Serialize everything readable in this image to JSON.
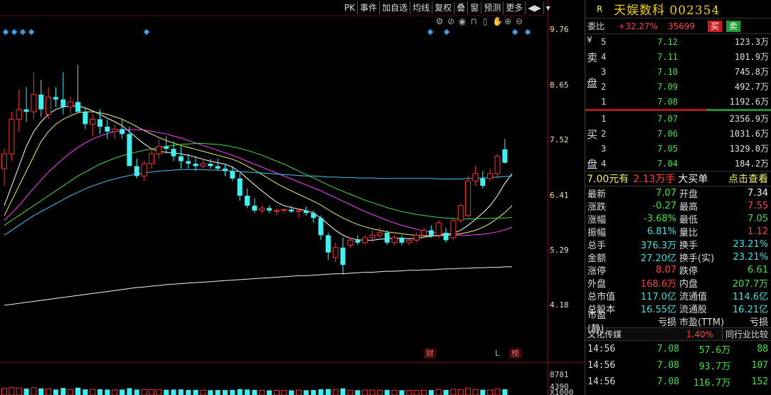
{
  "toolbar": [
    "PK",
    "事件",
    "加自选",
    "均线",
    "复权",
    "叠",
    "窗",
    "预测",
    "更多",
    "◀▶",
    "▾"
  ],
  "chart_data": {
    "type": "candlestick",
    "ylim": [
      3.8,
      10.2
    ],
    "price_ticks": [
      "9.76",
      "8.65",
      "7.52",
      "6.41",
      "5.29",
      "4.18"
    ],
    "volume_ticks": [
      "8781",
      "4390",
      "X1000"
    ],
    "candles": [
      {
        "o": 6.95,
        "h": 7.35,
        "l": 6.6,
        "c": 7.25
      },
      {
        "o": 7.25,
        "h": 8.1,
        "l": 7.1,
        "c": 7.95
      },
      {
        "o": 7.95,
        "h": 8.55,
        "l": 7.7,
        "c": 8.15
      },
      {
        "o": 8.15,
        "h": 8.6,
        "l": 7.9,
        "c": 8.1
      },
      {
        "o": 8.1,
        "h": 8.9,
        "l": 7.95,
        "c": 8.45
      },
      {
        "o": 8.45,
        "h": 8.75,
        "l": 8.0,
        "c": 8.15
      },
      {
        "o": 8.05,
        "h": 8.6,
        "l": 7.95,
        "c": 8.4
      },
      {
        "o": 8.4,
        "h": 8.6,
        "l": 8.2,
        "c": 8.35
      },
      {
        "o": 8.35,
        "h": 8.9,
        "l": 8.05,
        "c": 8.2
      },
      {
        "o": 8.2,
        "h": 8.4,
        "l": 8.05,
        "c": 8.3
      },
      {
        "o": 8.3,
        "h": 9.05,
        "l": 8.1,
        "c": 8.1
      },
      {
        "o": 8.1,
        "h": 8.2,
        "l": 7.75,
        "c": 7.85
      },
      {
        "o": 7.85,
        "h": 8.05,
        "l": 7.6,
        "c": 7.95
      },
      {
        "o": 7.95,
        "h": 8.15,
        "l": 7.65,
        "c": 7.8
      },
      {
        "o": 7.8,
        "h": 7.95,
        "l": 7.55,
        "c": 7.7
      },
      {
        "o": 7.7,
        "h": 7.85,
        "l": 7.55,
        "c": 7.75
      },
      {
        "o": 7.75,
        "h": 7.95,
        "l": 7.55,
        "c": 7.65
      },
      {
        "o": 7.65,
        "h": 7.8,
        "l": 7.0,
        "c": 7.0
      },
      {
        "o": 7.0,
        "h": 7.15,
        "l": 6.75,
        "c": 6.8
      },
      {
        "o": 6.8,
        "h": 7.1,
        "l": 6.7,
        "c": 7.05
      },
      {
        "o": 7.05,
        "h": 7.35,
        "l": 6.95,
        "c": 7.25
      },
      {
        "o": 7.25,
        "h": 7.55,
        "l": 7.15,
        "c": 7.4
      },
      {
        "o": 7.4,
        "h": 7.6,
        "l": 7.25,
        "c": 7.35
      },
      {
        "o": 7.35,
        "h": 7.5,
        "l": 7.1,
        "c": 7.2
      },
      {
        "o": 7.2,
        "h": 7.4,
        "l": 6.95,
        "c": 7.1
      },
      {
        "o": 7.1,
        "h": 7.25,
        "l": 6.95,
        "c": 7.05
      },
      {
        "o": 7.05,
        "h": 7.2,
        "l": 6.9,
        "c": 7.0
      },
      {
        "o": 7.0,
        "h": 7.15,
        "l": 6.95,
        "c": 7.05
      },
      {
        "o": 7.05,
        "h": 7.15,
        "l": 6.95,
        "c": 7.0
      },
      {
        "o": 7.0,
        "h": 7.15,
        "l": 6.9,
        "c": 6.95
      },
      {
        "o": 6.95,
        "h": 7.05,
        "l": 6.8,
        "c": 6.9
      },
      {
        "o": 6.9,
        "h": 7.0,
        "l": 6.7,
        "c": 6.75
      },
      {
        "o": 6.75,
        "h": 6.85,
        "l": 6.3,
        "c": 6.4
      },
      {
        "o": 6.4,
        "h": 6.55,
        "l": 6.15,
        "c": 6.2
      },
      {
        "o": 6.2,
        "h": 6.35,
        "l": 6.05,
        "c": 6.1
      },
      {
        "o": 6.1,
        "h": 6.2,
        "l": 6.05,
        "c": 6.15
      },
      {
        "o": 6.15,
        "h": 6.2,
        "l": 6.05,
        "c": 6.1
      },
      {
        "o": 6.1,
        "h": 6.15,
        "l": 6.0,
        "c": 6.1
      },
      {
        "o": 6.1,
        "h": 6.15,
        "l": 6.05,
        "c": 6.12
      },
      {
        "o": 6.12,
        "h": 6.2,
        "l": 6.05,
        "c": 6.08
      },
      {
        "o": 6.08,
        "h": 6.15,
        "l": 5.95,
        "c": 6.1
      },
      {
        "o": 6.1,
        "h": 6.18,
        "l": 6.0,
        "c": 6.05
      },
      {
        "o": 6.05,
        "h": 6.1,
        "l": 5.85,
        "c": 5.95
      },
      {
        "o": 5.95,
        "h": 6.0,
        "l": 5.5,
        "c": 5.6
      },
      {
        "o": 5.6,
        "h": 5.65,
        "l": 5.1,
        "c": 5.25
      },
      {
        "o": 5.15,
        "h": 5.45,
        "l": 5.05,
        "c": 5.35
      },
      {
        "o": 5.35,
        "h": 5.55,
        "l": 4.8,
        "c": 5.0
      },
      {
        "o": 5.4,
        "h": 5.55,
        "l": 5.35,
        "c": 5.5
      },
      {
        "o": 5.5,
        "h": 5.6,
        "l": 5.4,
        "c": 5.45
      },
      {
        "o": 5.45,
        "h": 5.6,
        "l": 5.4,
        "c": 5.55
      },
      {
        "o": 5.55,
        "h": 5.7,
        "l": 5.45,
        "c": 5.6
      },
      {
        "o": 5.6,
        "h": 5.75,
        "l": 5.55,
        "c": 5.65
      },
      {
        "o": 5.65,
        "h": 5.7,
        "l": 5.4,
        "c": 5.45
      },
      {
        "o": 5.45,
        "h": 5.6,
        "l": 5.4,
        "c": 5.55
      },
      {
        "o": 5.55,
        "h": 5.6,
        "l": 5.4,
        "c": 5.45
      },
      {
        "o": 5.45,
        "h": 5.55,
        "l": 5.4,
        "c": 5.5
      },
      {
        "o": 5.5,
        "h": 5.65,
        "l": 5.45,
        "c": 5.6
      },
      {
        "o": 5.6,
        "h": 5.75,
        "l": 5.55,
        "c": 5.7
      },
      {
        "o": 5.7,
        "h": 5.8,
        "l": 5.55,
        "c": 5.6
      },
      {
        "o": 5.6,
        "h": 5.9,
        "l": 5.55,
        "c": 5.85
      },
      {
        "o": 5.65,
        "h": 5.75,
        "l": 5.45,
        "c": 5.5
      },
      {
        "o": 5.55,
        "h": 5.95,
        "l": 5.5,
        "c": 5.9
      },
      {
        "o": 5.9,
        "h": 6.25,
        "l": 5.85,
        "c": 6.2
      },
      {
        "o": 6.0,
        "h": 6.8,
        "l": 5.95,
        "c": 6.7
      },
      {
        "o": 6.7,
        "h": 7.0,
        "l": 6.6,
        "c": 6.85
      },
      {
        "o": 6.75,
        "h": 6.9,
        "l": 6.55,
        "c": 6.6
      },
      {
        "o": 6.75,
        "h": 6.95,
        "l": 6.7,
        "c": 6.85
      },
      {
        "o": 6.85,
        "h": 7.25,
        "l": 6.75,
        "c": 7.2
      },
      {
        "o": 7.34,
        "h": 7.55,
        "l": 7.05,
        "c": 7.07
      }
    ],
    "ma_lines": [
      {
        "color": "#ffffff",
        "values": [
          6.2,
          6.6,
          7.0,
          7.4,
          7.7,
          7.9,
          8.05,
          8.15,
          8.2,
          8.22,
          8.22,
          8.18,
          8.12,
          8.05,
          7.97,
          7.9,
          7.82,
          7.7,
          7.57,
          7.45,
          7.35,
          7.3,
          7.28,
          7.27,
          7.25,
          7.22,
          7.18,
          7.14,
          7.1,
          7.07,
          7.04,
          6.98,
          6.88,
          6.75,
          6.62,
          6.5,
          6.38,
          6.27,
          6.2,
          6.16,
          6.13,
          6.1,
          6.05,
          5.95,
          5.82,
          5.7,
          5.6,
          5.54,
          5.51,
          5.5,
          5.5,
          5.52,
          5.53,
          5.54,
          5.54,
          5.53,
          5.54,
          5.56,
          5.58,
          5.6,
          5.62,
          5.64,
          5.7,
          5.8,
          5.92,
          6.05,
          6.2,
          6.4,
          6.65,
          6.85
        ]
      },
      {
        "color": "#f0f060",
        "values": [
          6.0,
          6.3,
          6.6,
          6.9,
          7.2,
          7.5,
          7.7,
          7.85,
          7.95,
          8.02,
          8.08,
          8.1,
          8.1,
          8.08,
          8.05,
          8.0,
          7.95,
          7.88,
          7.8,
          7.72,
          7.65,
          7.58,
          7.52,
          7.47,
          7.42,
          7.38,
          7.34,
          7.3,
          7.26,
          7.22,
          7.18,
          7.14,
          7.08,
          7.0,
          6.92,
          6.83,
          6.74,
          6.65,
          6.57,
          6.5,
          6.43,
          6.36,
          6.29,
          6.21,
          6.12,
          6.03,
          5.95,
          5.88,
          5.82,
          5.77,
          5.73,
          5.7,
          5.67,
          5.65,
          5.63,
          5.61,
          5.6,
          5.59,
          5.59,
          5.59,
          5.6,
          5.61,
          5.63,
          5.66,
          5.7,
          5.76,
          5.84,
          5.94,
          6.06,
          6.2
        ]
      },
      {
        "color": "#ff40ff",
        "values": [
          5.9,
          6.05,
          6.2,
          6.38,
          6.55,
          6.72,
          6.88,
          7.02,
          7.15,
          7.27,
          7.38,
          7.47,
          7.55,
          7.61,
          7.66,
          7.7,
          7.72,
          7.74,
          7.74,
          7.73,
          7.71,
          7.68,
          7.65,
          7.61,
          7.57,
          7.52,
          7.47,
          7.42,
          7.37,
          7.32,
          7.27,
          7.22,
          7.16,
          7.1,
          7.04,
          6.98,
          6.92,
          6.86,
          6.8,
          6.74,
          6.68,
          6.62,
          6.56,
          6.5,
          6.43,
          6.36,
          6.29,
          6.22,
          6.15,
          6.08,
          6.02,
          5.96,
          5.9,
          5.85,
          5.8,
          5.76,
          5.72,
          5.69,
          5.66,
          5.64,
          5.62,
          5.61,
          5.6,
          5.6,
          5.61,
          5.62,
          5.64,
          5.67,
          5.71,
          5.76
        ]
      },
      {
        "color": "#40e040",
        "values": [
          5.8,
          5.9,
          6.0,
          6.1,
          6.2,
          6.3,
          6.4,
          6.5,
          6.6,
          6.7,
          6.8,
          6.88,
          6.96,
          7.04,
          7.1,
          7.16,
          7.21,
          7.25,
          7.29,
          7.32,
          7.35,
          7.38,
          7.4,
          7.42,
          7.44,
          7.45,
          7.46,
          7.46,
          7.45,
          7.44,
          7.42,
          7.39,
          7.36,
          7.32,
          7.27,
          7.22,
          7.16,
          7.1,
          7.04,
          6.97,
          6.9,
          6.83,
          6.76,
          6.69,
          6.62,
          6.55,
          6.49,
          6.43,
          6.37,
          6.31,
          6.26,
          6.21,
          6.16,
          6.12,
          6.08,
          6.05,
          6.02,
          6.0,
          5.98,
          5.96,
          5.95,
          5.94,
          5.93,
          5.93,
          5.93,
          5.94,
          5.94,
          5.95,
          5.95,
          5.96
        ]
      },
      {
        "color": "#40c8f0",
        "values": [
          5.6,
          5.7,
          5.8,
          5.9,
          6.0,
          6.08,
          6.16,
          6.24,
          6.32,
          6.4,
          6.47,
          6.54,
          6.6,
          6.65,
          6.7,
          6.74,
          6.78,
          6.81,
          6.84,
          6.86,
          6.88,
          6.9,
          6.91,
          6.92,
          6.93,
          6.93,
          6.93,
          6.93,
          6.92,
          6.92,
          6.91,
          6.9,
          6.89,
          6.88,
          6.87,
          6.86,
          6.85,
          6.84,
          6.83,
          6.82,
          6.81,
          6.8,
          6.8,
          6.79,
          6.78,
          6.78,
          6.77,
          6.77,
          6.76,
          6.76,
          6.76,
          6.75,
          6.75,
          6.75,
          6.75,
          6.75,
          6.75,
          6.75,
          6.75,
          6.74,
          6.74,
          6.74,
          6.74,
          6.75,
          6.75,
          6.76,
          6.77,
          6.78,
          6.79,
          6.8
        ]
      },
      {
        "color": "#f0f0f0",
        "values": [
          4.18,
          4.2,
          4.22,
          4.24,
          4.26,
          4.28,
          4.3,
          4.32,
          4.34,
          4.36,
          4.38,
          4.4,
          4.42,
          4.44,
          4.46,
          4.48,
          4.5,
          4.52,
          4.54,
          4.55,
          4.57,
          4.58,
          4.6,
          4.61,
          4.62,
          4.63,
          4.64,
          4.65,
          4.66,
          4.67,
          4.68,
          4.69,
          4.7,
          4.71,
          4.72,
          4.73,
          4.74,
          4.75,
          4.76,
          4.77,
          4.78,
          4.78,
          4.79,
          4.8,
          4.81,
          4.82,
          4.82,
          4.83,
          4.84,
          4.85,
          4.85,
          4.86,
          4.87,
          4.87,
          4.88,
          4.89,
          4.89,
          4.9,
          4.9,
          4.91,
          4.92,
          4.92,
          4.93,
          4.93,
          4.94,
          4.94,
          4.95,
          4.95,
          4.96,
          4.96
        ]
      }
    ]
  },
  "event_tags": [
    "财",
    "L",
    "榜"
  ],
  "panel": {
    "code_prefix": "R",
    "stock_name": "天娱数科 002354",
    "wb_label": "委比",
    "wb_pct": "+32.27%",
    "wb_diff": "35699",
    "btn_sell": "买",
    "btn_buy": "卖",
    "sell_side_chars": [
      "¥",
      "卖",
      "盘"
    ],
    "sell": [
      {
        "lvl": "5",
        "price": "7.12",
        "qty": "123.3万"
      },
      {
        "lvl": "4",
        "price": "7.11",
        "qty": "101.9万"
      },
      {
        "lvl": "3",
        "price": "7.10",
        "qty": "745.8万"
      },
      {
        "lvl": "2",
        "price": "7.09",
        "qty": "492.7万"
      },
      {
        "lvl": "1",
        "price": "7.08",
        "qty": "1192.6万"
      }
    ],
    "buy_side_chars": [
      "买",
      "盘"
    ],
    "buy": [
      {
        "lvl": "1",
        "price": "7.07",
        "qty": "2356.9万"
      },
      {
        "lvl": "2",
        "price": "7.06",
        "qty": "1031.6万"
      },
      {
        "lvl": "3",
        "price": "7.05",
        "qty": "1329.0万"
      },
      {
        "lvl": "4",
        "price": "7.04",
        "qty": "184.2万"
      }
    ],
    "big_order": {
      "price": "7.00元有",
      "qty": "2.13万手",
      "label": "大买单",
      "link": "点击查看"
    },
    "stats": [
      {
        "k1": "最新",
        "v1": "7.07",
        "c1": "cG",
        "k2": "开盘",
        "v2": "7.34",
        "c2": "cW"
      },
      {
        "k1": "涨跌",
        "v1": "-0.27",
        "c1": "cG",
        "k2": "最高",
        "v2": "7.55",
        "c2": "cR"
      },
      {
        "k1": "涨幅",
        "v1": "-3.68%",
        "c1": "cG",
        "k2": "最低",
        "v2": "7.05",
        "c2": "cG"
      },
      {
        "k1": "振幅",
        "v1": "6.81%",
        "c1": "cC",
        "k2": "量比",
        "v2": "1.12",
        "c2": "cR"
      },
      {
        "k1": "总手",
        "v1": "376.3万",
        "c1": "cC",
        "k2": "换手",
        "v2": "23.21%",
        "c2": "cC"
      },
      {
        "k1": "金额",
        "v1": "27.20亿",
        "c1": "cC",
        "k2": "换手(实)",
        "v2": "23.21%",
        "c2": "cC"
      },
      {
        "k1": "涨停",
        "v1": "8.07",
        "c1": "cR",
        "k2": "跌停",
        "v2": "6.61",
        "c2": "cG"
      },
      {
        "k1": "外盘",
        "v1": "168.6万",
        "c1": "cR",
        "k2": "内盘",
        "v2": "207.7万",
        "c2": "cG"
      },
      {
        "k1": "总市值",
        "v1": "117.0亿",
        "c1": "cC",
        "k2": "流通值",
        "v2": "114.6亿",
        "c2": "cC"
      },
      {
        "k1": "总股本",
        "v1": "16.55亿",
        "c1": "cC",
        "k2": "流通股",
        "v2": "16.21亿",
        "c2": "cC"
      },
      {
        "k1": "市盈(静)",
        "v1": "亏损",
        "c1": "cW",
        "k2": "市盈(TTM)",
        "v2": "亏损",
        "c2": "cW"
      }
    ],
    "industry": {
      "name": "文化传媒",
      "pct": "1.40%",
      "cmp": "同行业比较"
    },
    "ticks": [
      {
        "t": "14:56",
        "p": "7.08",
        "q": "57.6万",
        "n": "88"
      },
      {
        "t": "14:56",
        "p": "7.08",
        "q": "93.7万",
        "n": "107"
      },
      {
        "t": "14:56",
        "p": "7.08",
        "q": "116.7万",
        "n": "152"
      }
    ]
  }
}
